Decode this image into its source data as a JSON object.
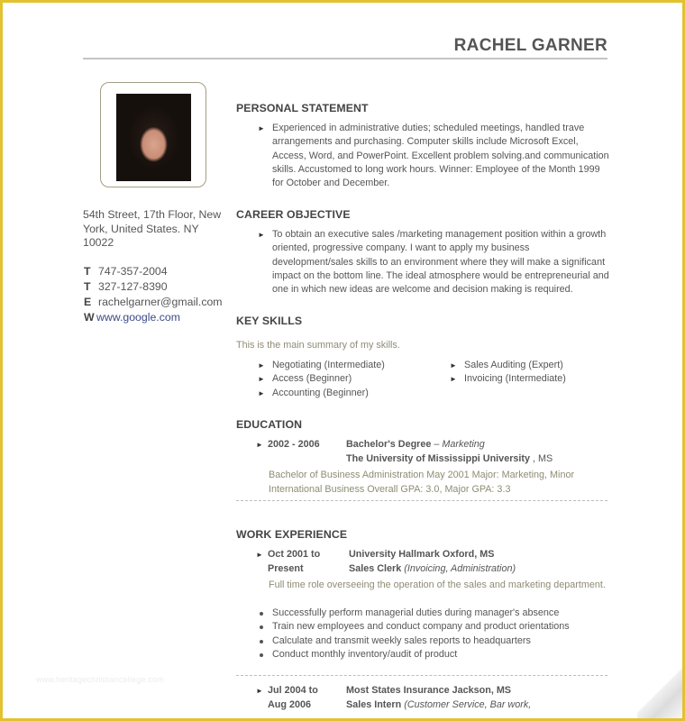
{
  "header": {
    "name": "RACHEL GARNER"
  },
  "sidebar": {
    "photo_alt": "profile-photo",
    "address": "54th Street, 17th Floor, New York, United States. NY 10022",
    "contacts": [
      {
        "key": "T",
        "value": "747-357-2004"
      },
      {
        "key": "T",
        "value": "327-127-8390"
      },
      {
        "key": "E",
        "value": "rachelgarner@gmail.com"
      },
      {
        "key": "W",
        "value": "www.google.com"
      }
    ]
  },
  "sections": {
    "personal_statement": {
      "title": "PERSONAL STATEMENT",
      "text": "Experienced in administrative duties; scheduled meetings, handled trave arrangements and purchasing. Computer skills include Microsoft Excel, Access, Word, and PowerPoint. Excellent problem solving.and communication skills. Accustomed to long work hours. Winner: Employee of the Month 1999 for October and December."
    },
    "career_objective": {
      "title": "CAREER OBJECTIVE",
      "text": "To obtain an executive sales /marketing management position within a growth oriented, progressive company. I want to apply my business development/sales skills to an environment where they will make a significant impact on the bottom line. The ideal atmosphere would be entrepreneurial and one in which new ideas are welcome and decision making is required."
    },
    "key_skills": {
      "title": "KEY SKILLS",
      "intro": "This is the main summary of my skills.",
      "column1": [
        "Negotiating (Intermediate)",
        "Access (Beginner)",
        "Accounting (Beginner)"
      ],
      "column2": [
        "Sales Auditing (Expert)",
        "Invoicing (Intermediate)"
      ]
    },
    "education": {
      "title": "EDUCATION",
      "entries": [
        {
          "date": "2002 - 2006",
          "degree": "Bachelor's Degree",
          "separator": " – ",
          "field": "Marketing",
          "school": "The University of Mississippi University",
          "location": " , MS",
          "note": "Bachelor of Business Administration May 2001 Major: Marketing, Minor International Business Overall GPA: 3.0, Major GPA: 3.3"
        }
      ]
    },
    "work_experience": {
      "title": "WORK EXPERIENCE",
      "entries": [
        {
          "date_line1": "Oct 2001 to",
          "date_line2": "Present",
          "company": "University Hallmark Oxford, MS",
          "role": "Sales Clerk",
          "role_detail": "(Invoicing, Administration)",
          "note": "Full time role overseeing the operation of the sales and marketing department.",
          "bullets": [
            "Successfully perform managerial duties during manager's absence",
            "Train new employees and conduct company and product orientations",
            "Calculate and transmit weekly sales reports to headquarters",
            "Conduct monthly inventory/audit of product"
          ]
        },
        {
          "date_line1": "Jul 2004 to",
          "date_line2": "Aug 2006",
          "company": "Most States Insurance Jackson, MS",
          "role": "Sales Intern",
          "role_detail": "(Customer Service, Bar work,"
        }
      ]
    }
  },
  "watermark": "www.heritagechristiancollege.com",
  "colors": {
    "frame": "#e2c22e",
    "muted_text": "#8e8c74",
    "link": "#3d4a86",
    "heading": "#444444"
  }
}
